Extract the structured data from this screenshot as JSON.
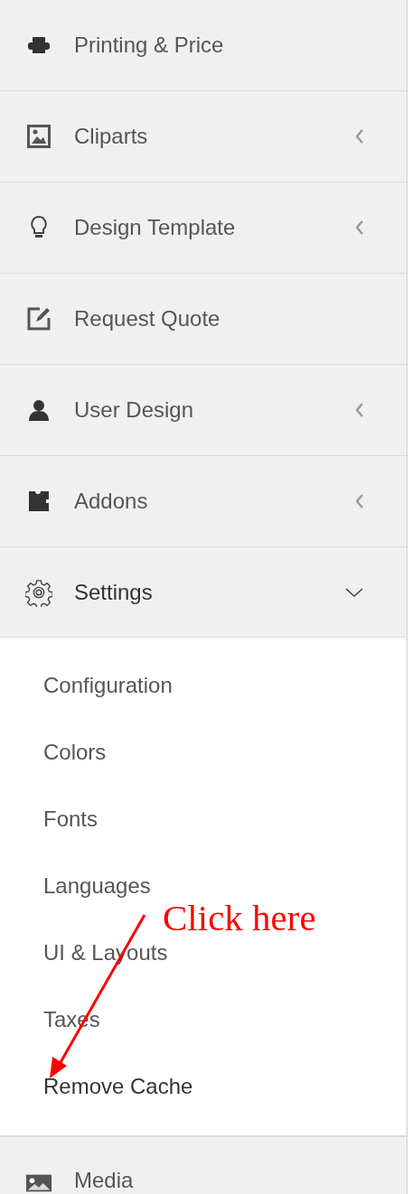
{
  "sidebar": {
    "items": [
      {
        "label": "Printing & Price",
        "has_children": false,
        "expanded": false
      },
      {
        "label": "Cliparts",
        "has_children": true,
        "expanded": false
      },
      {
        "label": "Design Template",
        "has_children": true,
        "expanded": false
      },
      {
        "label": "Request Quote",
        "has_children": false,
        "expanded": false
      },
      {
        "label": "User Design",
        "has_children": true,
        "expanded": false
      },
      {
        "label": "Addons",
        "has_children": true,
        "expanded": false
      },
      {
        "label": "Settings",
        "has_children": true,
        "expanded": true,
        "children": [
          {
            "label": "Configuration"
          },
          {
            "label": "Colors"
          },
          {
            "label": "Fonts"
          },
          {
            "label": "Languages"
          },
          {
            "label": "UI & Layouts"
          },
          {
            "label": "Taxes"
          },
          {
            "label": "Remove Cache"
          }
        ]
      },
      {
        "label": "Media",
        "has_children": false,
        "expanded": false
      }
    ]
  },
  "annotation": {
    "text": "Click here"
  }
}
